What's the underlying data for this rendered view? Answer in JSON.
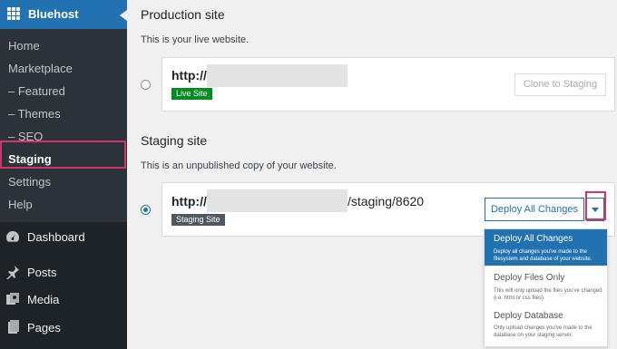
{
  "sidebar": {
    "brand": "Bluehost",
    "submenu": [
      "Home",
      "Marketplace",
      "– Featured",
      "– Themes",
      "– SEO",
      "Staging",
      "Settings",
      "Help"
    ],
    "active_item": "Staging",
    "menu": [
      {
        "label": "Dashboard",
        "icon": "dashboard-icon"
      },
      {
        "label": "Posts",
        "icon": "pushpin-icon"
      },
      {
        "label": "Media",
        "icon": "media-icon"
      },
      {
        "label": "Pages",
        "icon": "pages-icon"
      }
    ]
  },
  "production": {
    "title": "Production site",
    "description": "This is your live website.",
    "url_prefix": "http://",
    "badge": "Live Site",
    "clone_button": "Clone to Staging"
  },
  "staging": {
    "title": "Staging site",
    "description": "This is an unpublished copy of your website.",
    "url_prefix": "http://",
    "url_suffix": "/staging/8620",
    "badge": "Staging Site",
    "deploy_button": "Deploy All Changes"
  },
  "deploy_menu": [
    {
      "title": "Deploy All Changes",
      "desc": "Deploy all changes you've made to the filesystem and database of your website.",
      "selected": true
    },
    {
      "title": "Deploy Files Only",
      "desc": "This will only upload the files you've changed (i.e. html or css files).",
      "selected": false
    },
    {
      "title": "Deploy Database",
      "desc": "Only upload changes you've made to the database on your staging server.",
      "selected": false
    }
  ],
  "colors": {
    "accent": "#2271b1",
    "live_badge": "#008a20",
    "staging_badge": "#50575e",
    "highlight": "#d6336c"
  }
}
